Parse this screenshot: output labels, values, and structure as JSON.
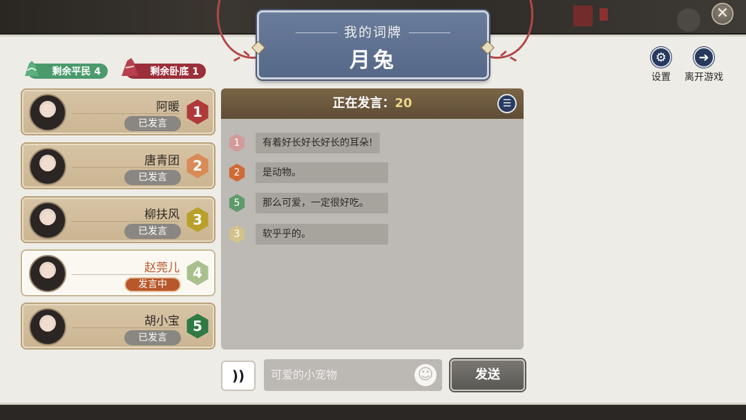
{
  "word_card": {
    "subtitle": "我的词牌",
    "word": "月兔"
  },
  "remaining": {
    "civilians": "剩余平民 4",
    "undercover": "剩余卧底 1",
    "civilian_color": "#4a9a6c",
    "undercover_color": "#9b2f3a"
  },
  "top_actions": {
    "settings": "设置",
    "leave": "离开游戏"
  },
  "players": [
    {
      "name": "阿暖",
      "status": "已发言",
      "number": "1",
      "color": "#b03a3a",
      "active": false
    },
    {
      "name": "唐青团",
      "status": "已发言",
      "number": "2",
      "color": "#d98b57",
      "active": false
    },
    {
      "name": "柳扶风",
      "status": "已发言",
      "number": "3",
      "color": "#b8a02a",
      "active": false
    },
    {
      "name": "赵莞儿",
      "status": "发言中",
      "number": "4",
      "color": "#a9c08d",
      "active": true
    },
    {
      "name": "胡小宝",
      "status": "已发言",
      "number": "5",
      "color": "#2f7a43",
      "active": false
    }
  ],
  "chat": {
    "title_prefix": "正在发言：",
    "timer": "20",
    "messages": [
      {
        "number": "1",
        "text": "有着好长好长好长的耳朵!",
        "color": "#d39a9a"
      },
      {
        "number": "2",
        "text": "是动物。",
        "color": "#cf6a36"
      },
      {
        "number": "5",
        "text": "那么可爱，一定很好吃。",
        "color": "#5f9a6a"
      },
      {
        "number": "3",
        "text": "软乎乎的。",
        "color": "#d3c38a"
      }
    ]
  },
  "input": {
    "value": "可爱的小宠物",
    "send_label": "发送"
  }
}
